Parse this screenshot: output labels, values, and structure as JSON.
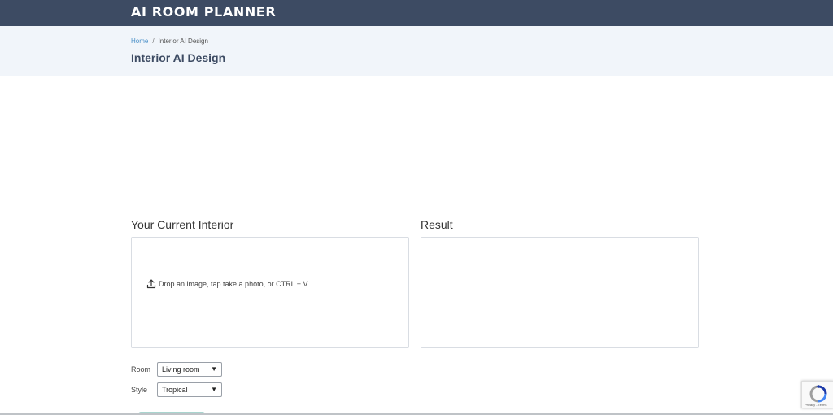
{
  "header": {
    "brand": "AI ROOM PLANNER"
  },
  "subheader": {
    "breadcrumb": {
      "home": "Home",
      "separator": "/",
      "current": "Interior AI Design"
    },
    "title": "Interior AI Design"
  },
  "main": {
    "current_panel": {
      "title": "Your Current Interior",
      "drop_hint": "Drop an image, tap take a photo, or CTRL + V",
      "icon": "upload-icon"
    },
    "result_panel": {
      "title": "Result"
    },
    "form": {
      "room": {
        "label": "Room",
        "value": "Living room"
      },
      "style": {
        "label": "Style",
        "value": "Tropical"
      }
    }
  },
  "recaptcha": {
    "legal": "Privacy - Terms",
    "icon": "recaptcha-icon"
  },
  "colors": {
    "header_bg": "#3d4b63",
    "subheader_bg": "#f1f5fa",
    "link": "#4a90c8",
    "title": "#3d4b63",
    "accent": "#a9d5cf"
  }
}
